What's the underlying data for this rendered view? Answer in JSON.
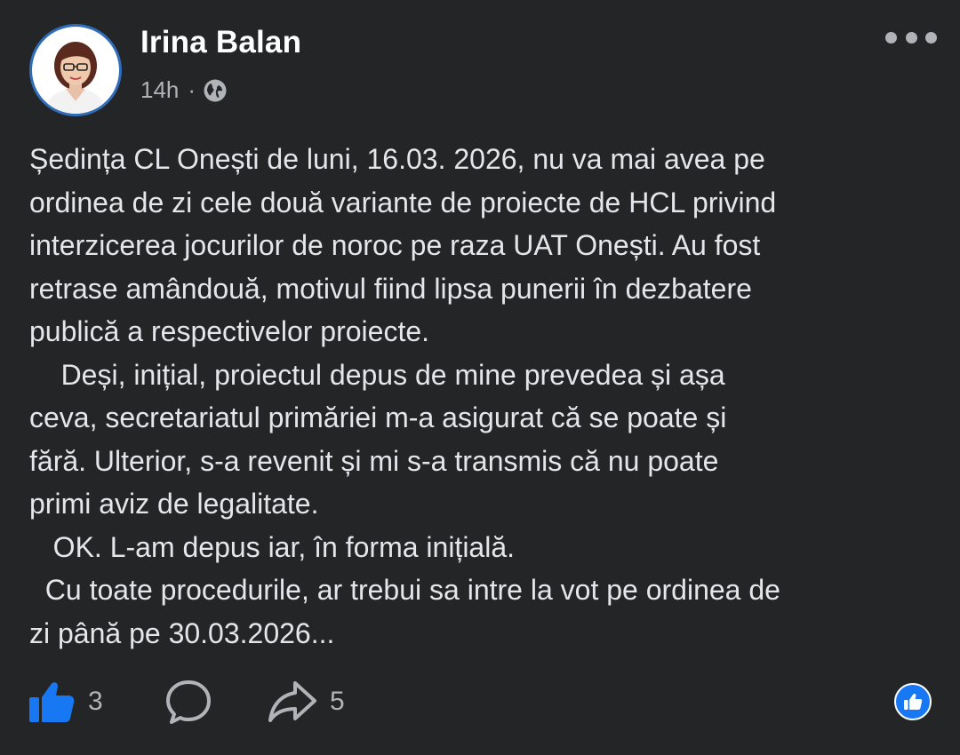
{
  "post": {
    "author": "Irina Balan",
    "timestamp": "14h",
    "separator": "·",
    "audience_icon": "globe-icon",
    "more_icon": "more-options-icon",
    "body": "Ședința CL Onești de luni, 16.03. 2026, nu va mai avea pe\nordinea de zi cele două variante de proiecte de HCL privind\ninterzicerea jocurilor de noroc pe raza UAT Onești. Au fost\nretrase amândouă, motivul fiind lipsa punerii în dezbatere\npublică a respectivelor proiecte.\n    Deși, inițial, proiectul depus de mine prevedea și așa\nceva, secretariatul primăriei m-a asigurat că se poate și\nfără. Ulterior, s-a revenit și mi s-a transmis că nu poate\nprimi aviz de legalitate.\n   OK. L-am depus iar, în forma inițială.\n  Cu toate procedurile, ar trebui sa intre la vot pe ordinea de\nzi până pe 30.03.2026..."
  },
  "actions": {
    "like": {
      "icon": "thumbs-up-icon",
      "count": "3",
      "color": "#1877f2"
    },
    "comment": {
      "icon": "comment-icon"
    },
    "share": {
      "icon": "share-icon",
      "count": "5"
    }
  },
  "reactions": {
    "icon": "like-reaction-icon",
    "color": "#1877f2"
  },
  "theme": {
    "background": "#242526",
    "text": "#e4e6eb",
    "secondary_text": "#b0b3b8"
  }
}
